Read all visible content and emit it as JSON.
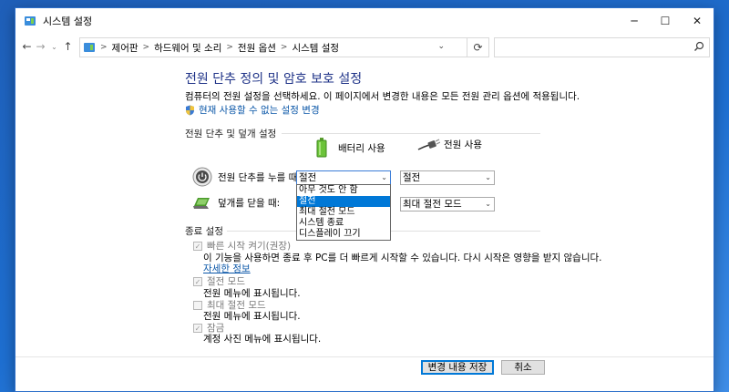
{
  "window": {
    "title": "시스템 설정"
  },
  "controls": {
    "minimize": "─",
    "maximize": "☐",
    "close": "✕"
  },
  "nav": {
    "back": "←",
    "forward": "→",
    "recent": "⌄",
    "up": "↑",
    "breadcrumb": [
      "제어판",
      "하드웨어 및 소리",
      "전원 옵션",
      "시스템 설정"
    ],
    "refresh": "⟳",
    "search_placeholder": ""
  },
  "page": {
    "title": "전원 단추 정의 및 암호 보호 설정",
    "description": "컴퓨터의 전원 설정을 선택하세요. 이 페이지에서 변경한 내용은 모든 전원 관리 옵션에 적용됩니다.",
    "admin_link": "현재 사용할 수 없는 설정 변경"
  },
  "buttons_section": {
    "heading": "전원 단추 및 덮개 설정",
    "col_battery": "배터리 사용",
    "col_plugged": "전원 사용",
    "power_button_label": "전원 단추를 누를 때:",
    "lid_label": "덮개를 닫을 때:",
    "power_battery": "절전",
    "power_plugged": "절전",
    "lid_plugged": "최대 절전 모드",
    "dropdown_options": [
      "아무 것도 안 함",
      "절전",
      "최대 절전 모드",
      "시스템 종료",
      "디스플레이 끄기"
    ],
    "dropdown_selected_index": 1
  },
  "shutdown_section": {
    "heading": "종료 설정",
    "fast_startup": "빠른 시작 켜기(권장)",
    "fast_startup_desc": "이 기능을 사용하면 종료 후 PC를 더 빠르게 시작할 수 있습니다. 다시 시작은 영향을 받지 않습니다.",
    "learn_more": "자세한 정보",
    "sleep": "절전 모드",
    "sleep_desc": "전원 메뉴에 표시됩니다.",
    "hibernate": "최대 절전 모드",
    "hibernate_desc": "전원 메뉴에 표시됩니다.",
    "lock": "잠금",
    "lock_desc": "계정 사진 메뉴에 표시됩니다."
  },
  "footer": {
    "save": "변경 내용 저장",
    "cancel": "취소"
  },
  "colors": {
    "title_blue": "#1e3287",
    "link_blue": "#0b57a8",
    "accent": "#0078d7"
  }
}
